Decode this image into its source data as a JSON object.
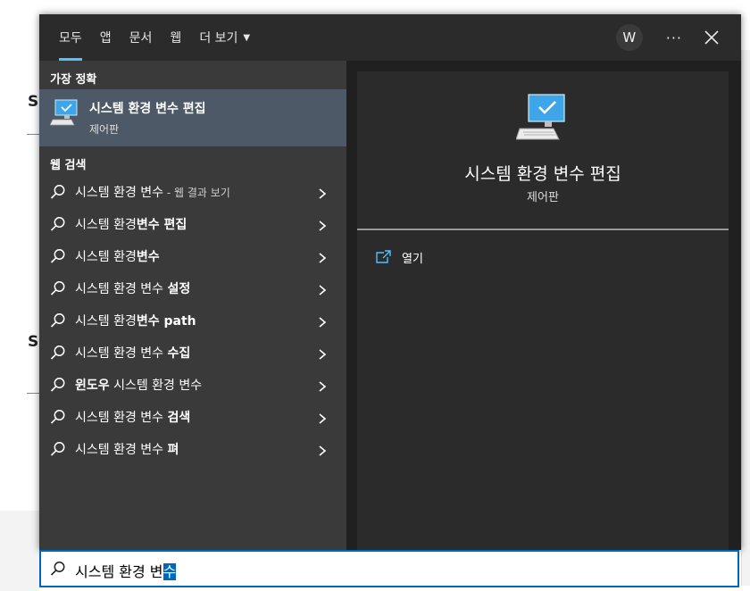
{
  "background": {
    "letters": [
      "S",
      "S"
    ]
  },
  "tabs": [
    {
      "label": "모두",
      "active": true
    },
    {
      "label": "앱"
    },
    {
      "label": "문서"
    },
    {
      "label": "웹"
    },
    {
      "label": "더 보기",
      "dropdown": true
    }
  ],
  "user": {
    "initial": "W"
  },
  "more_label": "···",
  "best_match": {
    "heading": "가장 정확",
    "title": "시스템 환경 변수 편집",
    "subtitle": "제어판"
  },
  "web_search": {
    "heading": "웹 검색",
    "items": [
      {
        "normal": "시스템 환경 변수",
        "bold": "",
        "suffix": " - 웹 결과 보기"
      },
      {
        "normal": "시스템 환경",
        "bold": "변수 편집",
        "suffix": ""
      },
      {
        "normal": "시스템 환경",
        "bold": "변수",
        "suffix": ""
      },
      {
        "normal": "시스템 환경 변수 ",
        "bold": "설정",
        "suffix": ""
      },
      {
        "normal": "시스템 환경",
        "bold": "변수 path",
        "suffix": ""
      },
      {
        "normal": "시스템 환경 변수 ",
        "bold": "수집",
        "suffix": ""
      },
      {
        "normal": "",
        "bold": "윈도우",
        "suffix": "",
        "rest": " 시스템 환경 변수"
      },
      {
        "normal": "시스템 환경 변수 ",
        "bold": "검색",
        "suffix": ""
      },
      {
        "normal": "시스템 환경 변수 ",
        "bold": "펴",
        "suffix": ""
      }
    ]
  },
  "preview": {
    "title": "시스템 환경 변수 편집",
    "subtitle": "제어판",
    "actions": [
      {
        "label": "열기"
      }
    ]
  },
  "search": {
    "query_prefix": "시스템 환경 변",
    "query_selected": "수"
  },
  "colors": {
    "accent": "#4cc2ff",
    "selection": "#0067c0",
    "highlight": "#4d5966"
  }
}
